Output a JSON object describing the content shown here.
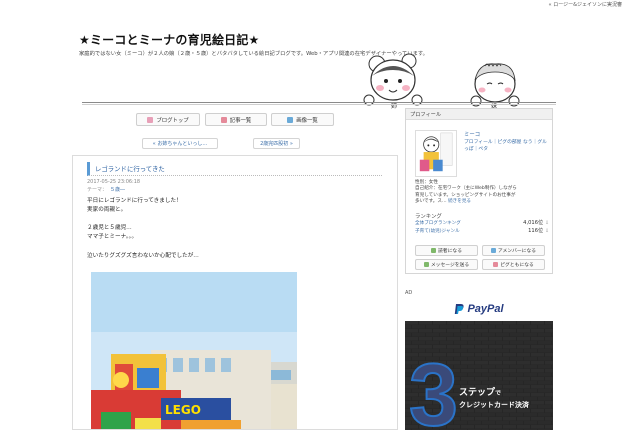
{
  "top_bar": {
    "link_text": "« ロージー&ジェイソンに実況審"
  },
  "blog": {
    "title": "★ミーコとミーナの育児絵日記★",
    "description": "家庭的ではない女（ミーコ）が２人の娘（２歳・５歳）とバタバタしている絵日記ブログです。Web・アプリ関連の在宅デザイナーやっています。"
  },
  "nav": {
    "items": [
      {
        "label": "ブログトップ",
        "icon": "house-icon",
        "color": "#e8a0b8"
      },
      {
        "label": "記事一覧",
        "icon": "list-icon",
        "color": "#e58a9a"
      },
      {
        "label": "画像一覧",
        "icon": "camera-icon",
        "color": "#6aaad8"
      }
    ]
  },
  "pager": {
    "prev": "« お姉ちゃんといっし…",
    "next": "2歳完匹股初 »"
  },
  "article": {
    "title": "レゴランドに行ってきた",
    "date": "2017-05-25 23:06:18",
    "theme_label": "テーマ：",
    "theme_value": "５歳―",
    "body_lines": [
      "平日にレゴランドに行ってきました！",
      "実家の両親と。",
      "",
      "２歳児と５歳児…",
      "ママ子とミーナ。。。",
      "",
      "泣いたりグズグズ言わないか心配でしたが…"
    ]
  },
  "sidebar": {
    "header": "プロフィール",
    "name": "ミーコ",
    "links": "プロフィール｜ピグの部屋 なう｜グルっぽ｜ペタ",
    "info_lines": [
      "性別：女性",
      "自己紹介：在宅ワーク（主にWeb制作）しながら",
      "育児しています。ショッピングサイトのお仕事が",
      "多いです。ス…"
    ],
    "more": "続きを見る",
    "ranking_title": "ランキング",
    "rankings": [
      {
        "label": "全体ブログランキング",
        "value": "4,016位"
      },
      {
        "label": "子育て(幼児)ジャンル",
        "value": "116位"
      }
    ],
    "buttons": [
      {
        "label": "読者になる",
        "color": "#7fb86a"
      },
      {
        "label": "アメンバーになる",
        "color": "#6aaad8"
      },
      {
        "label": "メッセージを送る",
        "color": "#7fb86a"
      },
      {
        "label": "ピグともになる",
        "color": "#e58a9a"
      }
    ]
  },
  "ad": {
    "label": "AD",
    "brand": "PayPal",
    "headline_main": "ステップ",
    "headline_suffix": "で",
    "headline_sub": "クレジットカード決済"
  }
}
